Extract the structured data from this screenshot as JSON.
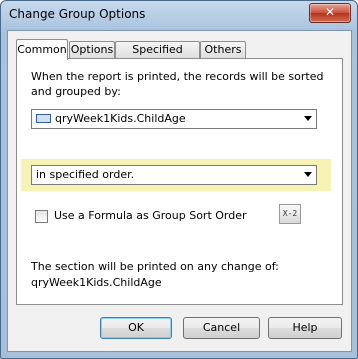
{
  "window": {
    "title": "Change Group Options",
    "close_label": "✕"
  },
  "tabs": [
    {
      "label": "Common"
    },
    {
      "label": "Options"
    },
    {
      "label": "Specified Order"
    },
    {
      "label": "Others"
    }
  ],
  "common": {
    "description": "When the report is printed, the records will be sorted and grouped by:",
    "group_field": {
      "value": "qryWeek1Kids.ChildAge",
      "icon": "database-field-icon"
    },
    "sort_order": {
      "value": "in specified order."
    },
    "formula_checkbox": {
      "label": "Use a Formula as Group Sort Order",
      "checked": false
    },
    "formula_button": {
      "label": "X-2",
      "icon": "formula-editor-icon"
    },
    "section_note": "The section will be printed on any change of:",
    "section_field": "qryWeek1Kids.ChildAge"
  },
  "buttons": {
    "ok": "OK",
    "cancel": "Cancel",
    "help": "Help"
  },
  "colors": {
    "highlight": "#f7f3b5",
    "titlebar": "#a9c3df",
    "close": "#c9523c"
  }
}
